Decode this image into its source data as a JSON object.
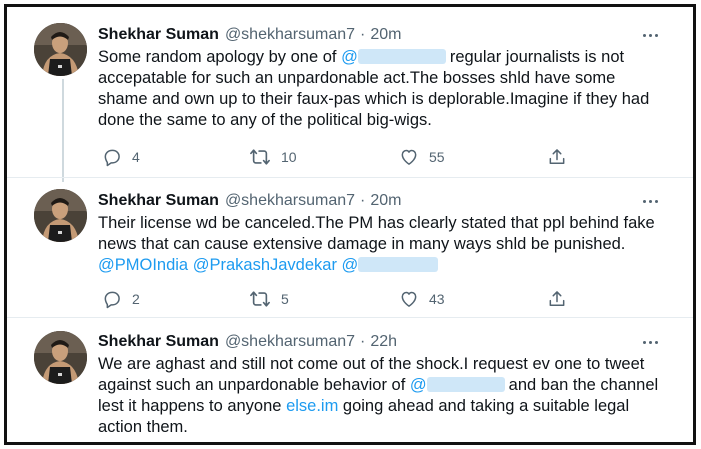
{
  "colors": {
    "accent": "#1d9bf0",
    "secondary_text": "#536471",
    "redaction": "#cce6f8",
    "frame_border": "#111111"
  },
  "tweets": [
    {
      "name": "Shekhar Suman",
      "handle": "@shekharsuman7",
      "separator": "·",
      "time": "20m",
      "text_parts": [
        "Some random apology by one of ",
        "regular journalists is not accepatable for such an unpardonable act.The bosses shld have some shame and own up to their faux-pas which is deplorable.Imagine if they had done the same to any of the political big-wigs."
      ],
      "mention_prefix": "@",
      "replies": "4",
      "retweets": "10",
      "likes": "55",
      "icons": [
        "reply-icon",
        "retweet-icon",
        "like-icon",
        "share-icon",
        "more-icon"
      ]
    },
    {
      "name": "Shekhar Suman",
      "handle": "@shekharsuman7",
      "separator": "·",
      "time": "20m",
      "text": "Their license wd be canceled.The PM has clearly stated that ppl behind fake news that can cause extensive damage in many ways shld be punished.",
      "mentions": [
        "@PMOIndia",
        "@PrakashJavdekar"
      ],
      "mention_prefix": "@",
      "replies": "2",
      "retweets": "5",
      "likes": "43"
    },
    {
      "name": "Shekhar Suman",
      "handle": "@shekharsuman7",
      "separator": "·",
      "time": "22h",
      "text_parts": [
        "We are aghast and still not come out of the shock.I request ev one to tweet against such an unpardonable behavior of ",
        "and ban the channel lest it happens to anyone ",
        " going ahead and taking a suitable legal action them."
      ],
      "link": "else.im",
      "mention_prefix": "@"
    }
  ]
}
